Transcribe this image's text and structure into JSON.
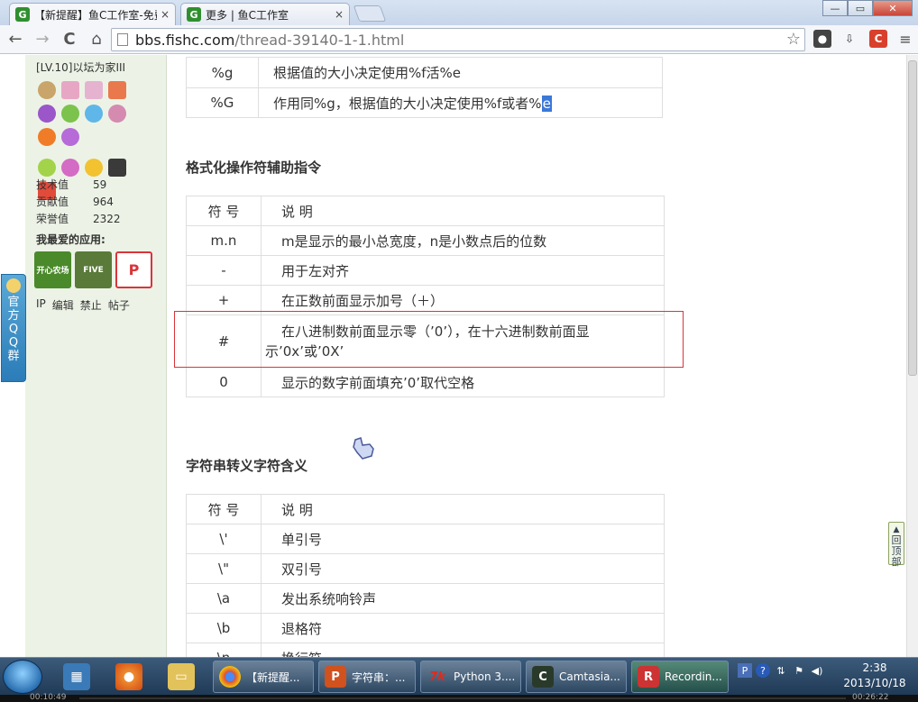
{
  "browser": {
    "tabs": [
      {
        "label": "【新提醒】鱼C工作室-免费",
        "favicon": "G",
        "close": "×",
        "active": true
      },
      {
        "label": "更多 | 鱼C工作室",
        "favicon": "G",
        "close": "×",
        "active": false
      }
    ],
    "window_controls": {
      "minimize": "—",
      "maximize": "▭",
      "close": "✕"
    },
    "url_host": "bbs.fishc.com",
    "url_path": "/thread-39140-1-1.html",
    "nav": {
      "back": "←",
      "forward": "→",
      "reload": "C",
      "home": "⌂"
    }
  },
  "sidebar": {
    "rank": "[LV.10]以坛为家III",
    "stats": [
      {
        "label": "技术值",
        "value": "59"
      },
      {
        "label": "贡献值",
        "value": "964"
      },
      {
        "label": "荣誉值",
        "value": "2322"
      }
    ],
    "favorites_title": "我最爱的应用:",
    "apps": [
      {
        "name": "game-app",
        "label": "开心农场",
        "color": "#4a8a2a"
      },
      {
        "name": "five-minutes-app",
        "label": "FIVE",
        "color": "#5a7a3a"
      },
      {
        "name": "p-app",
        "label": "P",
        "color": "#d9343a"
      }
    ],
    "user_links": [
      "IP",
      "编辑",
      "禁止",
      "帖子"
    ],
    "qq_badge": [
      "官",
      "方",
      "Q",
      "Q",
      "群"
    ]
  },
  "content": {
    "top_table": [
      {
        "symbol": "%g",
        "desc": "根据值的大小决定使用%f活%e"
      },
      {
        "symbol": "%G",
        "desc_pre": "作用同%g，根据值的大小决定使用%f或者%",
        "desc_hl": "e"
      }
    ],
    "section1_title": "格式化操作符辅助指令",
    "table1_header": {
      "symbol": "符  号",
      "desc": "说    明"
    },
    "table1": [
      {
        "symbol": "m.n",
        "desc": "m是显示的最小总宽度，n是小数点后的位数"
      },
      {
        "symbol": "-",
        "desc": "用于左对齐"
      },
      {
        "symbol": "+",
        "desc": "在正数前面显示加号（＋）"
      },
      {
        "symbol": "#",
        "desc_line1": "在八进制数前面显示零（’0’），在十六进制数前面显",
        "desc_line2": "示’0x’或’0X’"
      },
      {
        "symbol": "0",
        "desc": "显示的数字前面填充’0’取代空格"
      }
    ],
    "section2_title": "字符串转义字符含义",
    "table2_header": {
      "symbol": "符  号",
      "desc": "说    明"
    },
    "table2": [
      {
        "symbol": "\\'",
        "desc": "单引号"
      },
      {
        "symbol": "\\\"",
        "desc": "双引号"
      },
      {
        "symbol": "\\a",
        "desc": "发出系统响铃声"
      },
      {
        "symbol": "\\b",
        "desc": "退格符"
      },
      {
        "symbol": "\\n",
        "desc": "换行符"
      }
    ],
    "back_to_top": [
      "回",
      "顶",
      "部"
    ]
  },
  "taskbar": {
    "tasks": [
      {
        "label": "【新提醒...",
        "icon": "chrome",
        "color": "#dd4b39"
      },
      {
        "label": "字符串：...",
        "icon": "P",
        "color": "#d0521f"
      },
      {
        "label": "Python 3....",
        "icon": "7k",
        "color": "#c0201e"
      },
      {
        "label": "Camtasia...",
        "icon": "C",
        "color": "#3a5a3a"
      },
      {
        "label": "Recordin...",
        "icon": "R",
        "color": "#2f7a2f"
      }
    ],
    "time": "2:38",
    "date": "2013/10/18"
  },
  "recorder": {
    "elapsed": "00:10:49",
    "total": "00:26:22"
  }
}
